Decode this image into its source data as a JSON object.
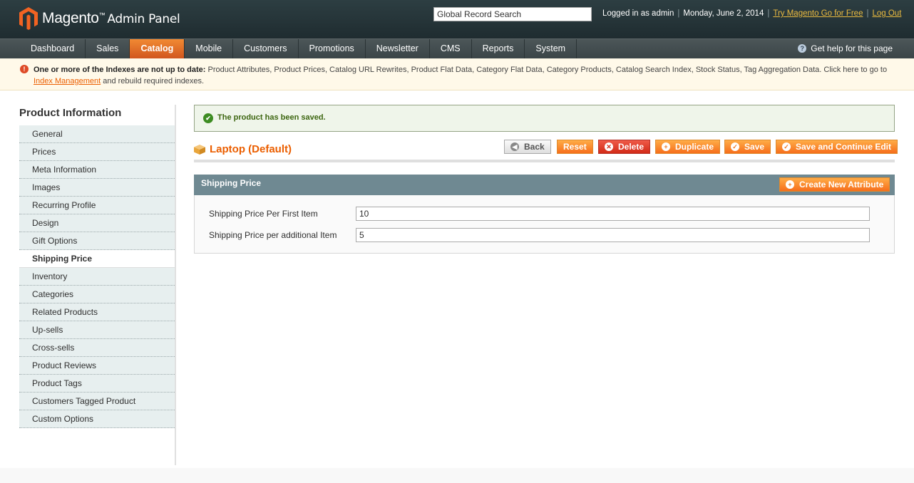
{
  "header": {
    "logo_brand": "Magento",
    "logo_tm": "™",
    "logo_sub": "Admin Panel",
    "search_value": "Global Record Search",
    "logged_in": "Logged in as admin",
    "date": "Monday, June 2, 2014",
    "try_link": "Try Magento Go for Free",
    "logout": "Log Out"
  },
  "nav": {
    "items": [
      {
        "label": "Dashboard"
      },
      {
        "label": "Sales"
      },
      {
        "label": "Catalog"
      },
      {
        "label": "Mobile"
      },
      {
        "label": "Customers"
      },
      {
        "label": "Promotions"
      },
      {
        "label": "Newsletter"
      },
      {
        "label": "CMS"
      },
      {
        "label": "Reports"
      },
      {
        "label": "System"
      }
    ],
    "active": "Catalog",
    "help": "Get help for this page"
  },
  "notice": {
    "bold": "One or more of the Indexes are not up to date:",
    "text": " Product Attributes, Product Prices, Catalog URL Rewrites, Product Flat Data, Category Flat Data, Category Products, Catalog Search Index, Stock Status, Tag Aggregation Data. Click here to go to",
    "link": "Index Management",
    "tail": " and rebuild required indexes."
  },
  "sidebar": {
    "title": "Product Information",
    "tabs": [
      {
        "label": "General"
      },
      {
        "label": "Prices"
      },
      {
        "label": "Meta Information"
      },
      {
        "label": "Images"
      },
      {
        "label": "Recurring Profile"
      },
      {
        "label": "Design"
      },
      {
        "label": "Gift Options"
      },
      {
        "label": "Shipping Price"
      },
      {
        "label": "Inventory"
      },
      {
        "label": "Categories"
      },
      {
        "label": "Related Products"
      },
      {
        "label": "Up-sells"
      },
      {
        "label": "Cross-sells"
      },
      {
        "label": "Product Reviews"
      },
      {
        "label": "Product Tags"
      },
      {
        "label": "Customers Tagged Product"
      },
      {
        "label": "Custom Options"
      }
    ],
    "active": "Shipping Price"
  },
  "main": {
    "success": "The product has been saved.",
    "product_title": "Laptop (Default)",
    "buttons": {
      "back": "Back",
      "reset": "Reset",
      "delete": "Delete",
      "duplicate": "Duplicate",
      "save": "Save",
      "save_continue": "Save and Continue Edit"
    },
    "fieldset": {
      "legend": "Shipping Price",
      "create_attribute": "Create New Attribute",
      "fields": [
        {
          "label": "Shipping Price Per First Item",
          "value": "10"
        },
        {
          "label": "Shipping Price per additional Item",
          "value": "5"
        }
      ]
    }
  },
  "colors": {
    "accent_orange": "#eb5e00",
    "header_dark": "#2d3e42",
    "fieldset_head": "#6f8992"
  }
}
